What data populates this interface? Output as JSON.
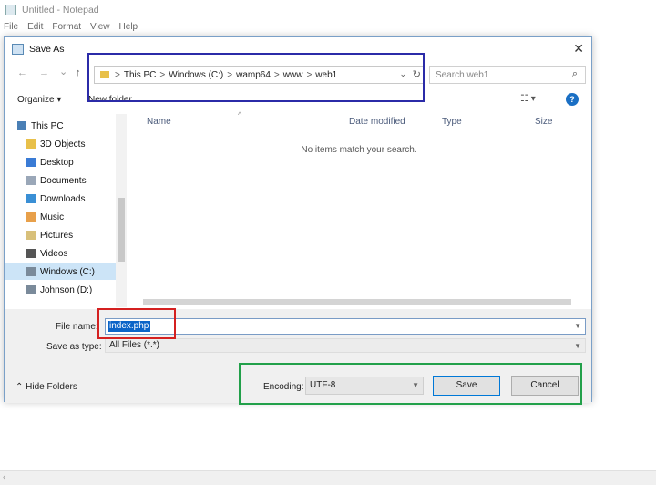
{
  "notepad": {
    "title": "Untitled - Notepad",
    "menu": [
      "File",
      "Edit",
      "Format",
      "View",
      "Help"
    ],
    "bottom_glyph": "‹"
  },
  "dialog": {
    "title": "Save As",
    "close_glyph": "✕",
    "nav": {
      "back": "←",
      "forward": "→",
      "recent": "⌄",
      "up": "↑"
    },
    "address": {
      "crumbs": [
        "This PC",
        "Windows (C:)",
        "wamp64",
        "www",
        "web1"
      ],
      "separator": ">",
      "dropdown": "⌄",
      "refresh": "↻"
    },
    "search": {
      "placeholder": "Search web1",
      "icon": "⌕"
    },
    "toolbar": {
      "organize": "Organize ▾",
      "new_folder": "New folder",
      "view": "☷ ▾",
      "help": "?"
    },
    "nav_pane": [
      {
        "label": "This PC",
        "icon": "pc-icon",
        "color": "#4a7fb5"
      },
      {
        "label": "3D Objects",
        "icon": "folder-icon",
        "color": "#e8c04a"
      },
      {
        "label": "Desktop",
        "icon": "folder-icon",
        "color": "#3a7bd5"
      },
      {
        "label": "Documents",
        "icon": "folder-icon",
        "color": "#9aa7b8"
      },
      {
        "label": "Downloads",
        "icon": "folder-icon",
        "color": "#3a8fd5"
      },
      {
        "label": "Music",
        "icon": "folder-icon",
        "color": "#e8a04a"
      },
      {
        "label": "Pictures",
        "icon": "folder-icon",
        "color": "#d8c07a"
      },
      {
        "label": "Videos",
        "icon": "folder-icon",
        "color": "#555555"
      },
      {
        "label": "Windows (C:)",
        "icon": "drive-icon",
        "color": "#7a8a9a"
      },
      {
        "label": "Johnson (D:)",
        "icon": "drive-icon",
        "color": "#7a8a9a"
      }
    ],
    "columns": [
      "Name",
      "Date modified",
      "Type",
      "Size"
    ],
    "sort_caret": "^",
    "empty_message": "No items match your search.",
    "file_name_label": "File name:",
    "file_name_value": "index.php",
    "save_type_label": "Save as type:",
    "save_type_value": "All Files (*.*)",
    "hide_folders": "⌃ Hide Folders",
    "encoding_label": "Encoding:",
    "encoding_value": "UTF-8",
    "save_label": "Save",
    "cancel_label": "Cancel"
  },
  "annotations": {
    "blue": "#2b2ba8",
    "red": "#d42020",
    "green": "#22a04a"
  }
}
